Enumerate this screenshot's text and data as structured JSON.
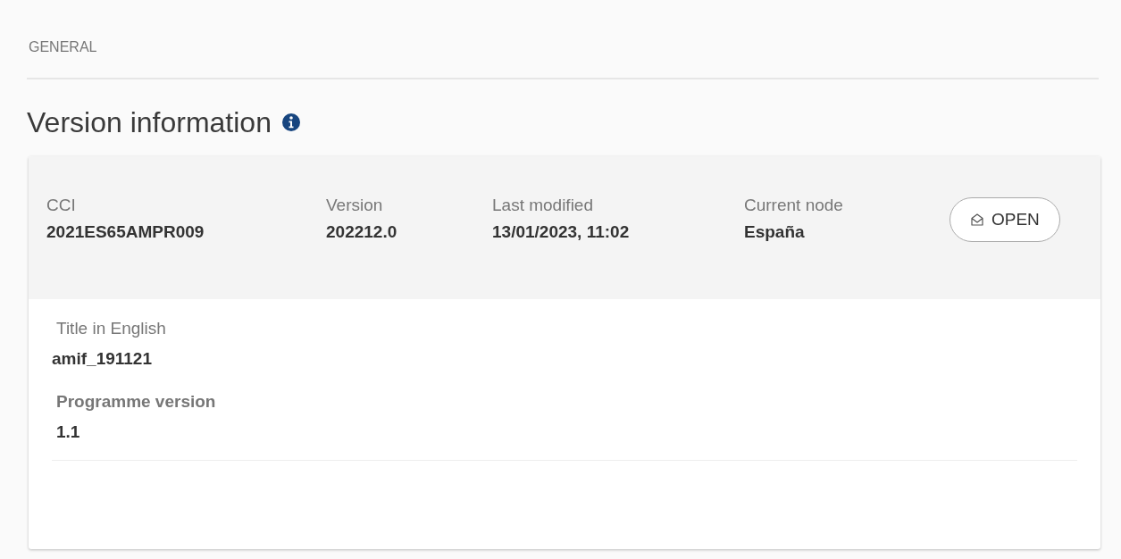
{
  "section_label": "GENERAL",
  "heading": {
    "title": "Version information"
  },
  "summary": {
    "fields": [
      {
        "label": "CCI",
        "value": "2021ES65AMPR009"
      },
      {
        "label": "Version",
        "value": "202212.0"
      },
      {
        "label": "Last modified",
        "value": "13/01/2023, 11:02"
      },
      {
        "label": "Current node",
        "value": "España"
      }
    ],
    "status_button": {
      "label": "OPEN"
    }
  },
  "details": [
    {
      "label": "Title in English",
      "value": "amif_191121",
      "label_bold": false
    },
    {
      "label": "Programme version",
      "value": "1.1",
      "label_bold": true
    }
  ]
}
